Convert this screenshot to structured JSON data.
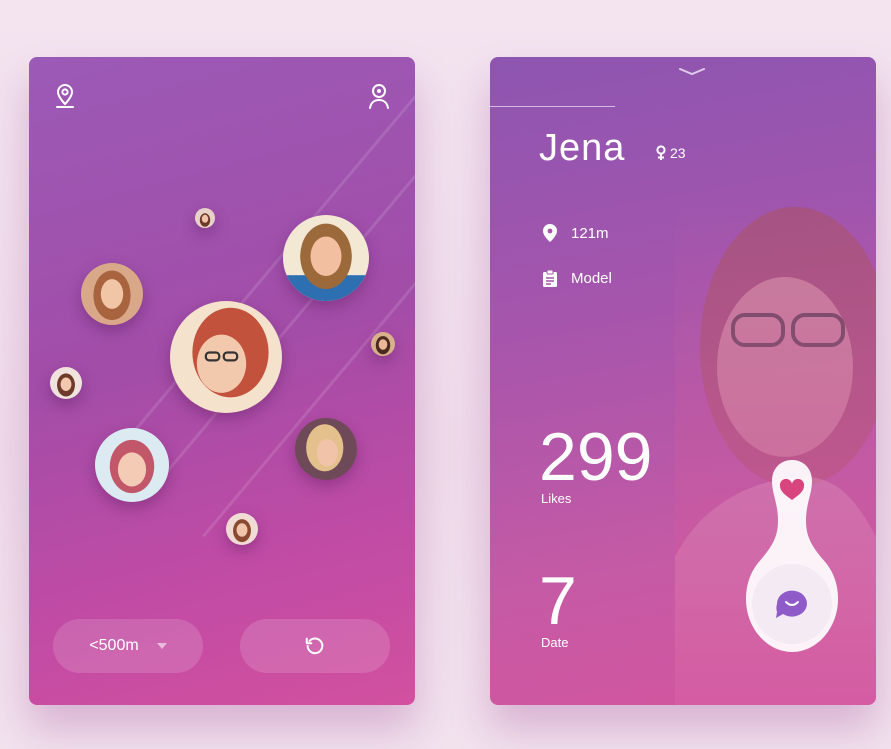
{
  "left_card": {
    "range_label": "<500m",
    "icons": [
      "location-pin-icon",
      "user-profile-icon",
      "refresh-icon",
      "dropdown-caret-icon"
    ]
  },
  "profile": {
    "name": "Jena",
    "age": "23",
    "distance": "121m",
    "occupation": "Model",
    "likes_count": "299",
    "likes_label": "Likes",
    "date_count": "7",
    "date_label": "Date"
  },
  "colors": {
    "accent_pink": "#d9457f",
    "chat_purple": "#8e5bc9",
    "gradient_top": "#9b5ab6",
    "gradient_bottom": "#d2509f"
  }
}
